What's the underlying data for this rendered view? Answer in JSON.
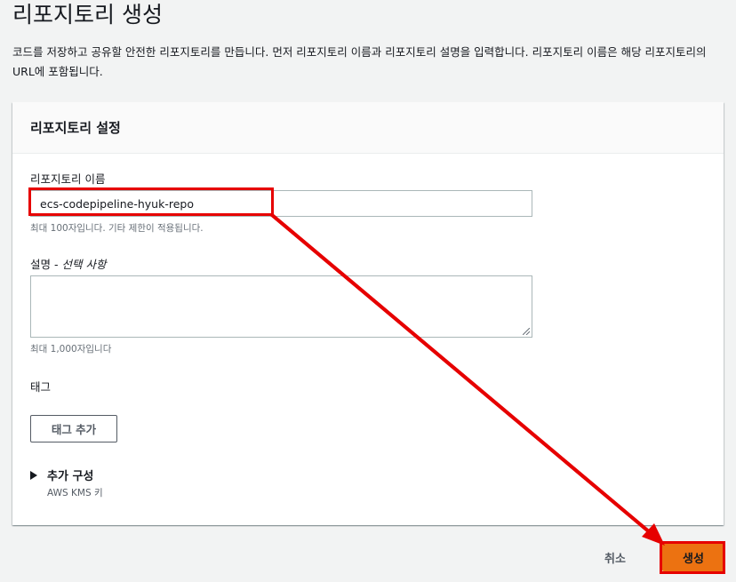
{
  "page": {
    "title": "리포지토리 생성",
    "description": "코드를 저장하고 공유할 안전한 리포지토리를 만듭니다. 먼저 리포지토리 이름과 리포지토리 설명을 입력합니다. 리포지토리 이름은 해당 리포지토리의 URL에 포함됩니다."
  },
  "settings_panel": {
    "title": "리포지토리 설정",
    "name_field": {
      "label": "리포지토리 이름",
      "value": "ecs-codepipeline-hyuk-repo",
      "hint": "최대 100자입니다. 기타 제한이 적용됩니다."
    },
    "description_field": {
      "label": "설명 - ",
      "optional": "선택 사항",
      "value": "",
      "hint": "최대 1,000자입니다"
    },
    "tags": {
      "label": "태그",
      "add_button": "태그 추가"
    },
    "additional_config": {
      "label": "추가 구성",
      "sub": "AWS KMS 키",
      "expanded": false
    }
  },
  "actions": {
    "cancel": "취소",
    "create": "생성"
  },
  "annotation": {
    "color": "#e60000",
    "accent": "#ec7211"
  }
}
